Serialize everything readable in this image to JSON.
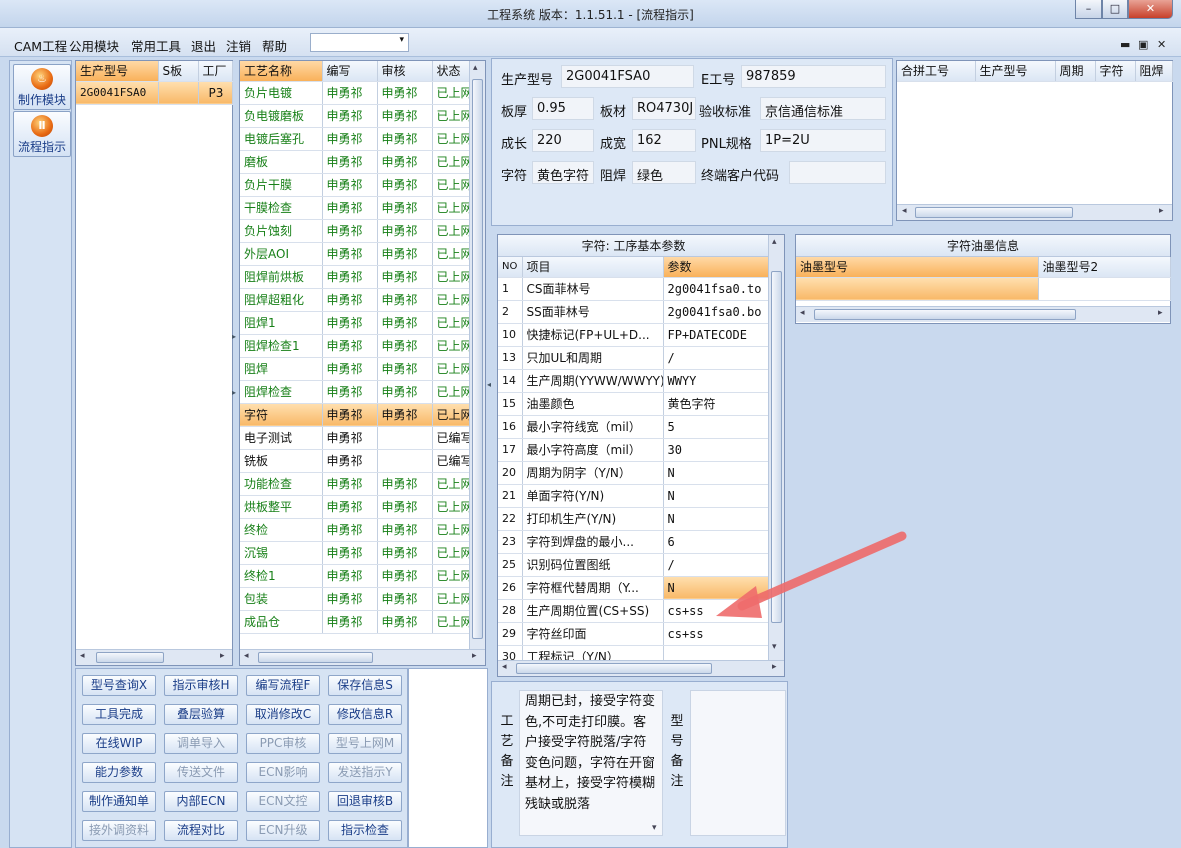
{
  "window": {
    "title": "工程系统   版本：1.1.51.1 - [流程指示]",
    "min": "–",
    "max": "□",
    "close": "✕"
  },
  "menu": [
    "CAM工程",
    "公用模块",
    "常用工具",
    "退出",
    "注销",
    "帮助"
  ],
  "menu_combo": {
    "arrow": "▾"
  },
  "mdi_controls": {
    "min": "▬",
    "restore": "▣",
    "close": "✕"
  },
  "nav": [
    {
      "label": "制作模块",
      "icon": "fire-icon"
    },
    {
      "label": "流程指示",
      "icon": "pause-icon"
    }
  ],
  "model_list": {
    "headers": [
      "生产型号",
      "S板",
      "工厂"
    ],
    "rows": [
      [
        "2G0041FSA0",
        "",
        "P3"
      ]
    ]
  },
  "process_list": {
    "headers": [
      "工艺名称",
      "编写",
      "审核",
      "状态"
    ],
    "rows": [
      [
        "负片电镀",
        "申勇祁",
        "申勇祁",
        "已上网"
      ],
      [
        "负电镀磨板",
        "申勇祁",
        "申勇祁",
        "已上网"
      ],
      [
        "电镀后塞孔",
        "申勇祁",
        "申勇祁",
        "已上网"
      ],
      [
        "磨板",
        "申勇祁",
        "申勇祁",
        "已上网"
      ],
      [
        "负片干膜",
        "申勇祁",
        "申勇祁",
        "已上网"
      ],
      [
        "干膜检查",
        "申勇祁",
        "申勇祁",
        "已上网"
      ],
      [
        "负片蚀刻",
        "申勇祁",
        "申勇祁",
        "已上网"
      ],
      [
        "外层AOI",
        "申勇祁",
        "申勇祁",
        "已上网"
      ],
      [
        "阻焊前烘板",
        "申勇祁",
        "申勇祁",
        "已上网"
      ],
      [
        "阻焊超粗化",
        "申勇祁",
        "申勇祁",
        "已上网"
      ],
      [
        "阻焊1",
        "申勇祁",
        "申勇祁",
        "已上网"
      ],
      [
        "阻焊检查1",
        "申勇祁",
        "申勇祁",
        "已上网"
      ],
      [
        "阻焊",
        "申勇祁",
        "申勇祁",
        "已上网"
      ],
      [
        "阻焊检查",
        "申勇祁",
        "申勇祁",
        "已上网"
      ],
      [
        "字符",
        "申勇祁",
        "申勇祁",
        "已上网"
      ],
      [
        "电子测试",
        "申勇祁",
        "",
        "已编写"
      ],
      [
        "铣板",
        "申勇祁",
        "",
        "已编写"
      ],
      [
        "功能检查",
        "申勇祁",
        "申勇祁",
        "已上网"
      ],
      [
        "烘板整平",
        "申勇祁",
        "申勇祁",
        "已上网"
      ],
      [
        "终检",
        "申勇祁",
        "申勇祁",
        "已上网"
      ],
      [
        "沉锡",
        "申勇祁",
        "申勇祁",
        "已上网"
      ],
      [
        "终检1",
        "申勇祁",
        "申勇祁",
        "已上网"
      ],
      [
        "包装",
        "申勇祁",
        "申勇祁",
        "已上网"
      ],
      [
        "成品仓",
        "申勇祁",
        "申勇祁",
        "已上网"
      ]
    ]
  },
  "buttons": [
    [
      "型号查询X",
      "指示审核H",
      "编写流程F",
      "保存信息S"
    ],
    [
      "工具完成",
      "叠层验算",
      "取消修改C",
      "修改信息R"
    ],
    [
      "在线WIP",
      "调单导入",
      "PPC审核",
      "型号上网M"
    ],
    [
      "能力参数",
      "传送文件",
      "ECN影响",
      "发送指示Y"
    ],
    [
      "制作通知单",
      "内部ECN",
      "ECN文控",
      "回退审核B"
    ],
    [
      "接外调资料",
      "流程对比",
      "ECN升级",
      "指示检查"
    ]
  ],
  "info": {
    "model_label": "生产型号",
    "model": "2G0041FSA0",
    "eno_label": "E工号",
    "eno": "987859",
    "thick_label": "板厚",
    "thick": "0.95",
    "material_label": "板材",
    "material": "RO4730J",
    "std_label": "验收标准",
    "std": "京信通信标准",
    "len_label": "成长",
    "len": "220",
    "wid_label": "成宽",
    "wid": "162",
    "pnl_label": "PNL规格",
    "pnl": "1P=2U",
    "char_label": "字符",
    "char": "黄色字符",
    "mask_label": "阻焊",
    "mask": "绿色",
    "cust_label": "终端客户代码",
    "cust": ""
  },
  "merge_grid": {
    "headers": [
      "合拼工号",
      "生产型号",
      "周期",
      "字符",
      "阻焊"
    ]
  },
  "params": {
    "title": "字符: 工序基本参数",
    "headers": [
      "NO",
      "项目",
      "参数"
    ],
    "rows": [
      [
        "1",
        "CS面菲林号",
        "2g0041fsa0.to"
      ],
      [
        "2",
        "SS面菲林号",
        "2g0041fsa0.bo"
      ],
      [
        "10",
        "快捷标记(FP+UL+D...",
        "FP+DATECODE"
      ],
      [
        "13",
        "只加UL和周期",
        "/"
      ],
      [
        "14",
        "生产周期(YYWW/WWYY)",
        "WWYY"
      ],
      [
        "15",
        "油墨颜色",
        "黄色字符"
      ],
      [
        "16",
        "最小字符线宽（mil）",
        "5"
      ],
      [
        "17",
        "最小字符高度（mil）",
        "30"
      ],
      [
        "20",
        "周期为阴字（Y/N）",
        "N"
      ],
      [
        "21",
        "单面字符(Y/N)",
        "N"
      ],
      [
        "22",
        "打印机生产(Y/N)",
        "N"
      ],
      [
        "23",
        "字符到焊盘的最小...",
        "6"
      ],
      [
        "25",
        "识别码位置图纸",
        "/"
      ],
      [
        "26",
        "字符框代替周期（Y...",
        "N"
      ],
      [
        "28",
        "生产周期位置(CS+SS)",
        "cs+ss"
      ],
      [
        "29",
        "字符丝印面",
        "cs+ss"
      ],
      [
        "30",
        "工程标记（Y/N）",
        ""
      ]
    ]
  },
  "ink": {
    "title": "字符油墨信息",
    "headers": [
      "油墨型号",
      "油墨型号2"
    ]
  },
  "remark": {
    "label": [
      "工",
      "艺",
      "备",
      "注"
    ],
    "text": "周期已封，接受字符变色,不可走打印膜。客户接受字符脱落/字符变色问题，字符在开窗基材上，接受字符模糊残缺或脱落",
    "label2": [
      "型",
      "号",
      "备",
      "注"
    ]
  },
  "scroll": {
    "left": "◂",
    "right": "▸",
    "up": "▴",
    "down": "▾",
    "grip": "⦙"
  },
  "colors": {
    "highlight": "#f8b868",
    "approved_text": "#188018",
    "arrow": "#ee6b6b"
  }
}
